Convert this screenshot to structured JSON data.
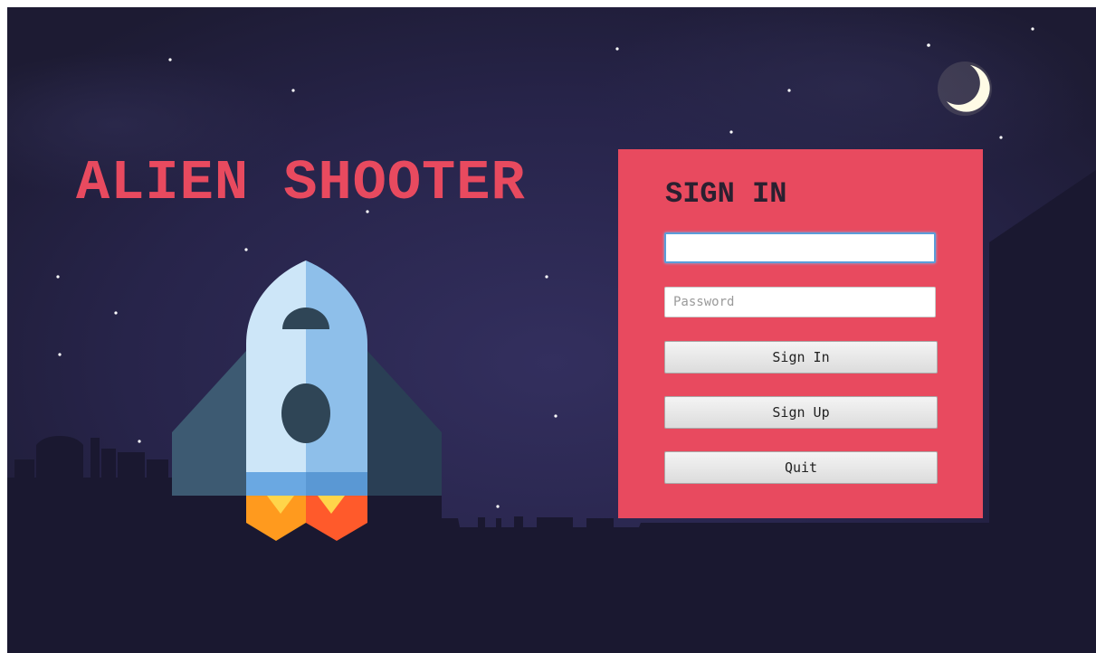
{
  "game": {
    "title": "ALIEN SHOOTER"
  },
  "signin": {
    "heading": "SIGN IN",
    "username_value": "",
    "password_placeholder": "Password",
    "signin_label": "Sign In",
    "signup_label": "Sign Up",
    "quit_label": "Quit"
  },
  "colors": {
    "accent": "#e84a5f",
    "sky_top": "#1e1c36",
    "sky_mid": "#302c58",
    "ground": "#181627",
    "rocket_body_light": "#cde6f8",
    "rocket_body_shade": "#8ebfea",
    "rocket_fins": "#3d5a72",
    "flame_outer": "#ff9a1e",
    "flame_inner": "#ffd54a"
  }
}
